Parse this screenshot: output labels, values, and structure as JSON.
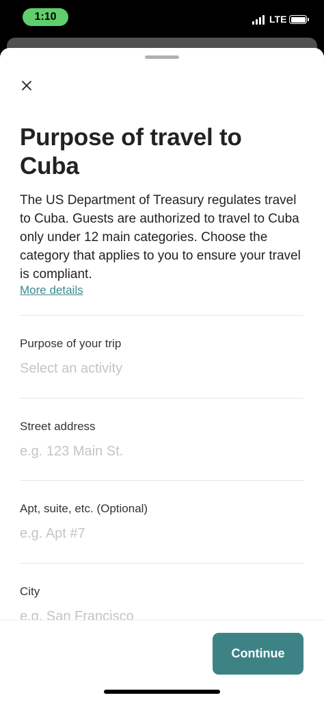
{
  "status_bar": {
    "time": "1:10",
    "network": "LTE"
  },
  "modal": {
    "close_icon": "close-icon",
    "title": "Purpose of travel to Cuba",
    "description": "The US Department of Treasury regulates travel to Cuba. Guests are authorized to travel to Cuba only under 12 main categories. Choose the category that applies to you to ensure your travel is compliant.",
    "more_link": "More details",
    "fields": [
      {
        "label": "Purpose of your trip",
        "placeholder": "Select an activity"
      },
      {
        "label": "Street address",
        "placeholder": "e.g. 123 Main St."
      },
      {
        "label": "Apt, suite, etc. (Optional)",
        "placeholder": "e.g. Apt #7"
      },
      {
        "label": "City",
        "placeholder": "e.g. San Francisco"
      }
    ],
    "continue_label": "Continue"
  },
  "colors": {
    "accent": "#3d8386",
    "link": "#3a8a8e",
    "time_pill": "#5fcf6b"
  }
}
